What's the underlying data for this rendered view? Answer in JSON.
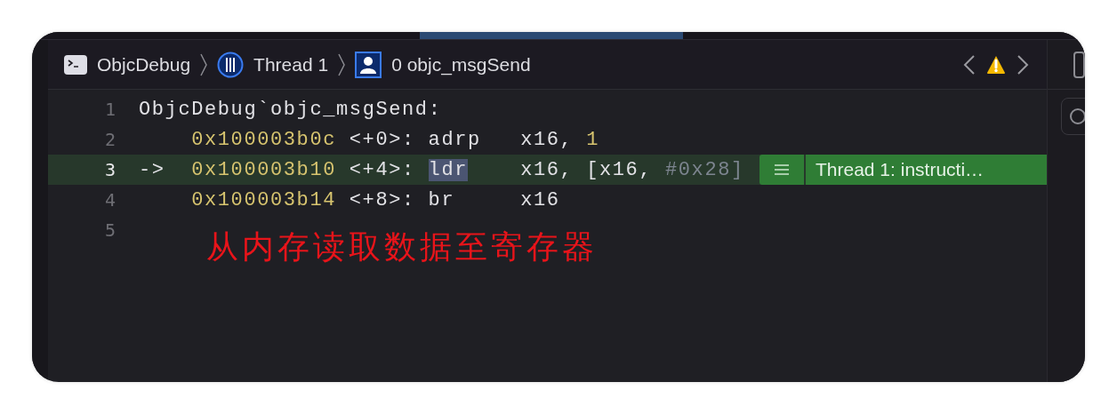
{
  "breadcrumb": [
    {
      "kind": "terminal",
      "label": "ObjcDebug"
    },
    {
      "kind": "thread",
      "label": "Thread 1"
    },
    {
      "kind": "frame",
      "label": "0 objc_msgSend"
    }
  ],
  "lines": [
    {
      "kind": "label",
      "number": "1",
      "current": false,
      "text": "ObjcDebug`objc_msgSend:"
    },
    {
      "kind": "instruction",
      "number": "2",
      "current": false,
      "address": "0x100003b0c",
      "offset": "<+0>:",
      "mnemonic": "adrp",
      "mnemonic_selected": false,
      "operands": [
        {
          "kind": "plain",
          "text": "x16, "
        },
        {
          "kind": "number",
          "text": "1"
        }
      ]
    },
    {
      "kind": "instruction",
      "number": "3",
      "current": true,
      "marker": "->",
      "address": "0x100003b10",
      "offset": "<+4>:",
      "mnemonic": "ldr",
      "mnemonic_selected": true,
      "operands": [
        {
          "kind": "plain",
          "text": "x16, [x16, "
        },
        {
          "kind": "immediate",
          "text": "#0x28]"
        }
      ],
      "badge": {
        "text": "Thread 1: instructi…"
      }
    },
    {
      "kind": "instruction",
      "number": "4",
      "current": false,
      "address": "0x100003b14",
      "offset": "<+8>:",
      "mnemonic": "br",
      "mnemonic_selected": false,
      "operands": [
        {
          "kind": "plain",
          "text": "x16"
        }
      ]
    },
    {
      "kind": "blank",
      "number": "5",
      "current": false
    }
  ],
  "annotation": "从内存读取数据至寄存器"
}
